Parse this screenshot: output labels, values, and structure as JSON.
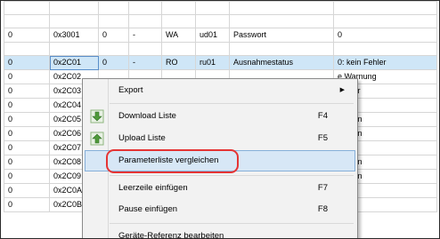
{
  "table": {
    "rows": [
      {
        "blank": true
      },
      {
        "blank": true
      },
      {
        "c": [
          "0",
          "0x3001",
          "0",
          "-",
          "WA",
          "ud01",
          "Passwort",
          "0"
        ]
      },
      {
        "blank": true
      },
      {
        "c": [
          "0",
          "0x2C01",
          "0",
          "-",
          "RO",
          "ru01",
          "Ausnahmestatus",
          "0: kein Fehler"
        ],
        "selected": true
      },
      {
        "c": [
          "0",
          "0x2C02",
          "",
          "",
          "",
          "",
          "",
          "e Warnung"
        ]
      },
      {
        "c": [
          "0",
          "0x2C03",
          "",
          "",
          "",
          "",
          "",
          " Fehler"
        ]
      },
      {
        "c": [
          "0",
          "0x2C04",
          "",
          "",
          "",
          "",
          "",
          "etrieb"
        ]
      },
      {
        "c": [
          "0",
          "0x2C05",
          "",
          "",
          "",
          "",
          "",
          ") 1/min"
        ]
      },
      {
        "c": [
          "0",
          "0x2C06",
          "",
          "",
          "",
          "",
          "",
          ") 1/min"
        ]
      },
      {
        "c": [
          "0",
          "0x2C07",
          "",
          "",
          "",
          "",
          "",
          ") Hz"
        ]
      },
      {
        "c": [
          "0",
          "0x2C08",
          "",
          "",
          "",
          "",
          "",
          ") 1/min"
        ]
      },
      {
        "c": [
          "0",
          "0x2C09",
          "",
          "",
          "",
          "",
          "",
          ") 1/min"
        ]
      },
      {
        "c": [
          "0",
          "0x2C0A",
          "",
          "",
          "",
          "",
          "",
          ""
        ]
      },
      {
        "c": [
          "0",
          "0x2C0B",
          "",
          "",
          "",
          "",
          "",
          ""
        ]
      }
    ]
  },
  "context_menu": {
    "export": "Export",
    "download_list": "Download Liste",
    "download_shortcut": "F4",
    "upload_list": "Upload Liste",
    "upload_shortcut": "F5",
    "compare": "Parameterliste vergleichen",
    "insert_blank_row": "Leerzeile einfügen",
    "insert_blank_row_shortcut": "F7",
    "insert_pause": "Pause einfügen",
    "insert_pause_shortcut": "F8",
    "edit_device_reference": "Geräte-Referenz bearbeiten"
  },
  "colors": {
    "selection_row": "#cfe6f7",
    "menu_highlight": "#d7e7f6",
    "annotation_circle": "#e53434",
    "download_icon": "#4f9a3a",
    "upload_icon": "#4f9a3a"
  },
  "icons": {
    "export_arrow": "chevron-right-icon",
    "download": "download-arrow-icon",
    "upload": "upload-arrow-icon"
  }
}
